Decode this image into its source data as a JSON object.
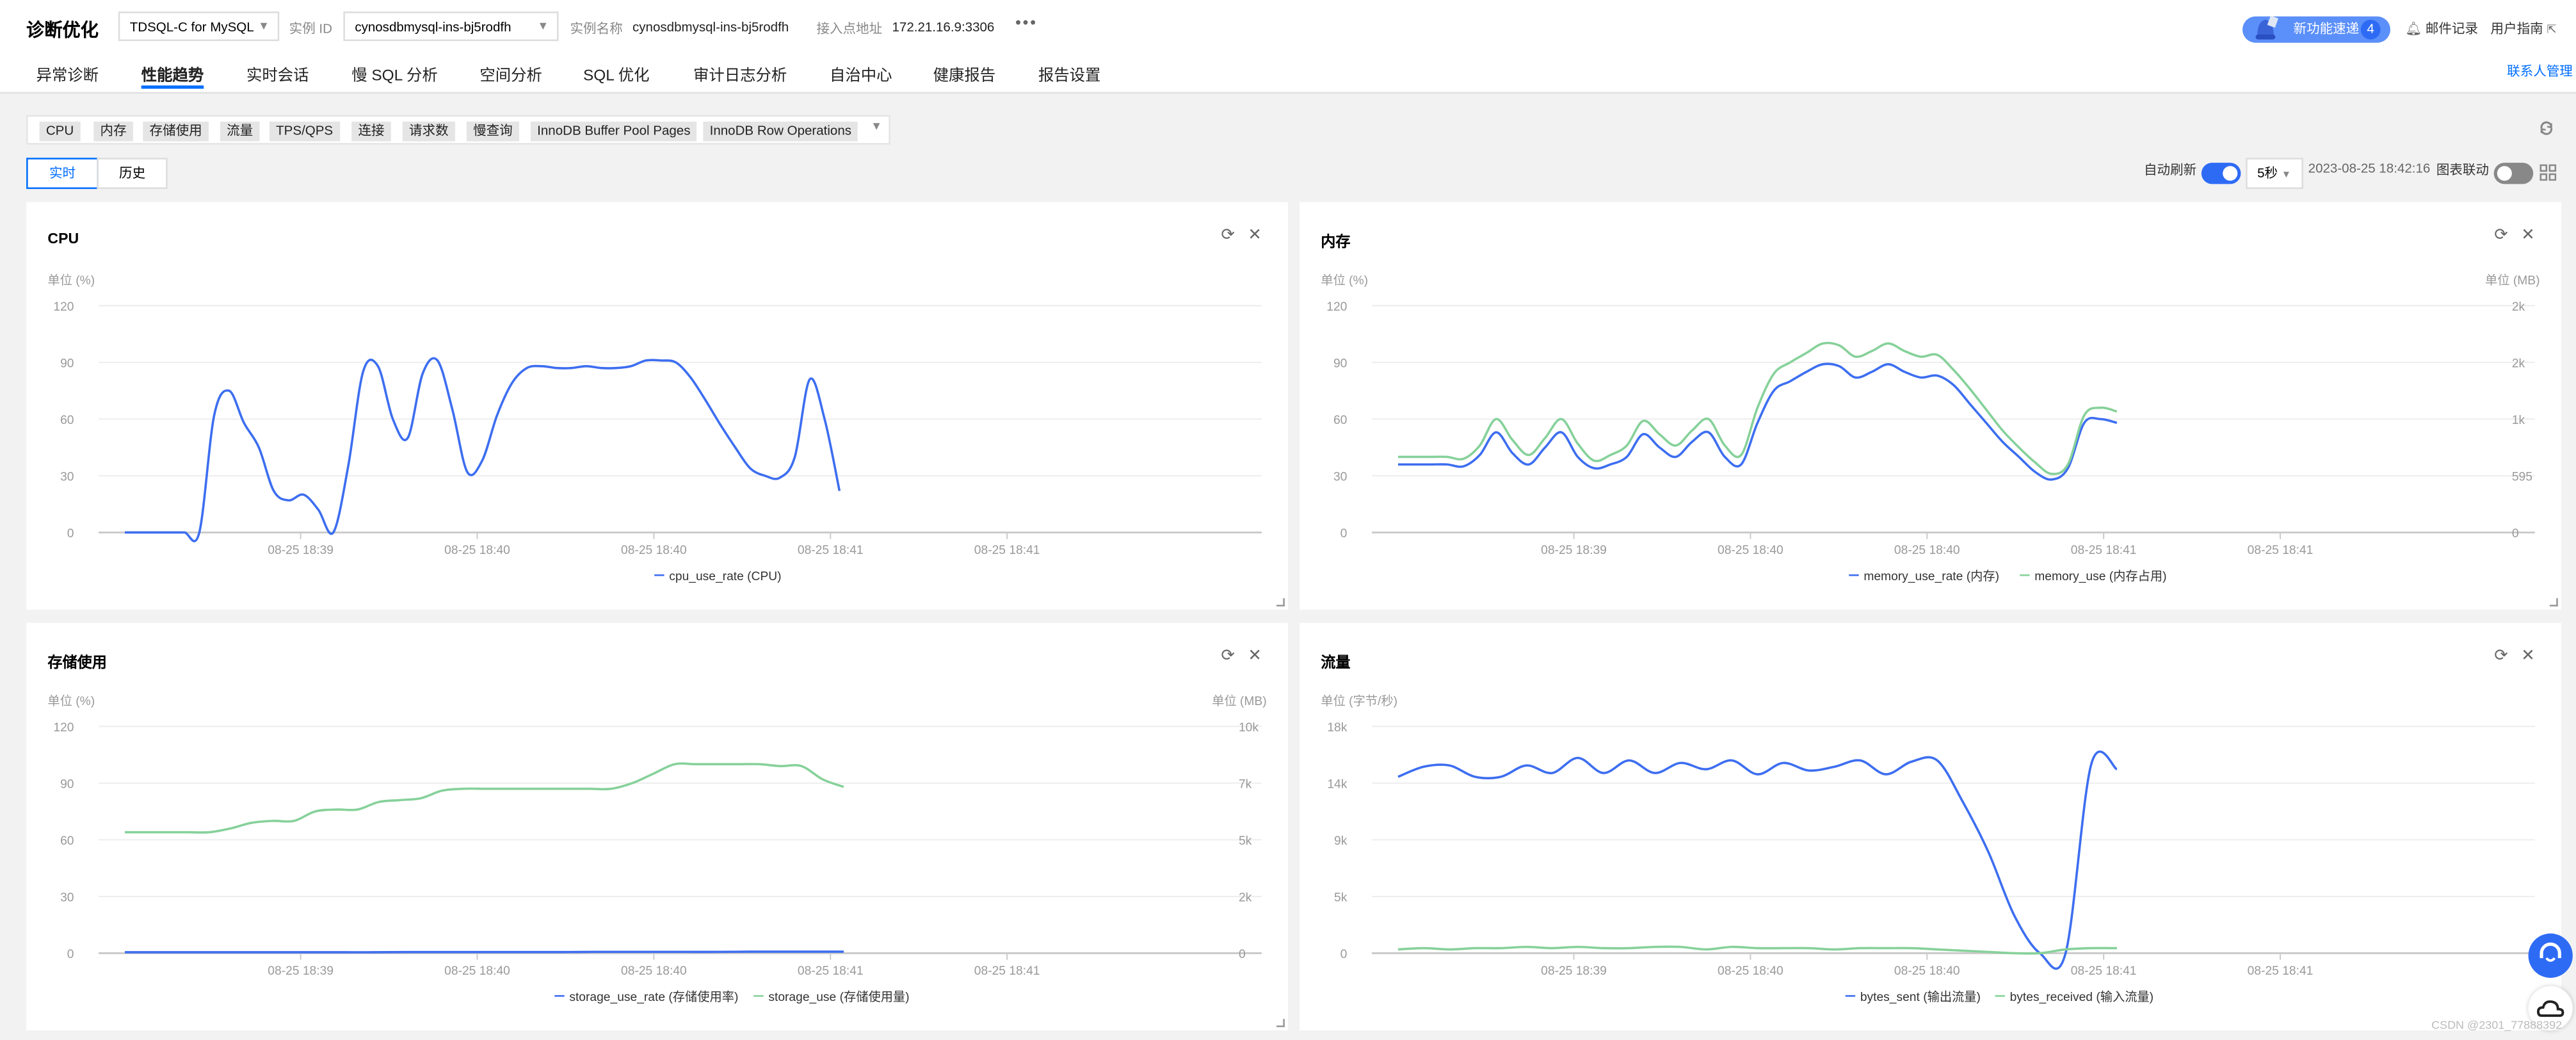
{
  "header": {
    "title": "诊断优化",
    "db_type": "TDSQL-C for MySQL",
    "instance_id_label": "实例 ID",
    "instance_id": "cynosdbmysql-ins-bj5rodfh",
    "instance_name_label": "实例名称",
    "instance_name": "cynosdbmysql-ins-bj5rodfh",
    "endpoint_label": "接入点地址",
    "endpoint": "172.21.16.9:3306",
    "more": "•••",
    "new_features_label": "新功能速递",
    "new_features_count": "4",
    "mail_label": "邮件记录",
    "guide_label": "用户指南",
    "contact_label": "联系人管理"
  },
  "tabs": [
    {
      "label": "异常诊断",
      "active": false
    },
    {
      "label": "性能趋势",
      "active": true
    },
    {
      "label": "实时会话",
      "active": false
    },
    {
      "label": "慢 SQL 分析",
      "active": false
    },
    {
      "label": "空间分析",
      "active": false
    },
    {
      "label": "SQL 优化",
      "active": false
    },
    {
      "label": "审计日志分析",
      "active": false
    },
    {
      "label": "自治中心",
      "active": false
    },
    {
      "label": "健康报告",
      "active": false
    },
    {
      "label": "报告设置",
      "active": false
    }
  ],
  "metric_chips": [
    "CPU",
    "内存",
    "存储使用",
    "流量",
    "TPS/QPS",
    "连接",
    "请求数",
    "慢查询",
    "InnoDB Buffer Pool Pages",
    "InnoDB Row Operations"
  ],
  "mode": {
    "realtime": "实时",
    "history": "历史",
    "selected": "实时"
  },
  "controls": {
    "auto_refresh_label": "自动刷新",
    "auto_refresh_on": true,
    "interval": "5秒",
    "timestamp": "2023-08-25 18:42:16",
    "chart_link_label": "图表联动",
    "chart_link_on": false
  },
  "colors": {
    "accent": "#006eff",
    "series_blue": "#3d6ef0",
    "series_green": "#86d19a"
  },
  "watermark": "CSDN @2301_77888392",
  "chart_data": [
    {
      "type": "line",
      "title": "CPU",
      "ylabel": "单位 (%)",
      "ylim": [
        0,
        120
      ],
      "yticks": [
        "0",
        "30",
        "60",
        "90",
        "120"
      ],
      "xticks": [
        "08-25 18:39",
        "08-25 18:40",
        "08-25 18:40",
        "08-25 18:41",
        "08-25 18:41"
      ],
      "series": [
        {
          "name": "cpu_use_rate (CPU)",
          "color": "#3d6ef0",
          "axis": "left",
          "values": [
            0,
            0,
            0,
            0,
            0,
            0,
            62,
            75,
            58,
            45,
            22,
            17,
            20,
            12,
            0,
            35,
            85,
            88,
            60,
            50,
            84,
            91,
            65,
            32,
            38,
            62,
            79,
            87,
            88,
            87,
            87,
            88,
            87,
            87,
            88,
            91,
            91,
            90,
            82,
            70,
            57,
            45,
            34,
            30,
            29,
            40,
            81,
            60,
            22
          ]
        }
      ]
    },
    {
      "type": "line",
      "title": "内存",
      "ylabel": "单位 (%)",
      "ylabel_right": "单位 (MB)",
      "ylim": [
        0,
        120
      ],
      "yticks": [
        "0",
        "30",
        "60",
        "90",
        "120"
      ],
      "yticks_right": [
        "0",
        "595",
        "1k",
        "2k",
        "2k"
      ],
      "xticks": [
        "08-25 18:39",
        "08-25 18:40",
        "08-25 18:40",
        "08-25 18:41",
        "08-25 18:41"
      ],
      "series": [
        {
          "name": "memory_use_rate (内存)",
          "color": "#3d6ef0",
          "axis": "left",
          "values": [
            36,
            36,
            36,
            36,
            35,
            41,
            53,
            42,
            36,
            45,
            53,
            40,
            34,
            36,
            40,
            52,
            45,
            40,
            48,
            53,
            40,
            36,
            58,
            75,
            80,
            85,
            89,
            88,
            82,
            85,
            89,
            85,
            82,
            83,
            78,
            68,
            58,
            48,
            40,
            32,
            28,
            34,
            58,
            60,
            58
          ]
        },
        {
          "name": "memory_use (内存占用)",
          "color": "#86d19a",
          "axis": "right",
          "values": [
            40,
            40,
            40,
            40,
            39,
            46,
            60,
            49,
            41,
            50,
            60,
            47,
            38,
            41,
            46,
            59,
            52,
            46,
            54,
            60,
            46,
            41,
            66,
            84,
            90,
            95,
            100,
            99,
            93,
            96,
            100,
            96,
            93,
            94,
            86,
            76,
            65,
            54,
            45,
            37,
            31,
            36,
            62,
            66,
            64
          ]
        }
      ]
    },
    {
      "type": "line",
      "title": "存储使用",
      "ylabel": "单位 (%)",
      "ylabel_right": "单位 (MB)",
      "ylim": [
        0,
        120
      ],
      "yticks": [
        "0",
        "30",
        "60",
        "90",
        "120"
      ],
      "yticks_right": [
        "0",
        "2k",
        "5k",
        "7k",
        "10k"
      ],
      "xticks": [
        "08-25 18:39",
        "08-25 18:40",
        "08-25 18:40",
        "08-25 18:41",
        "08-25 18:41"
      ],
      "series": [
        {
          "name": "storage_use_rate (存储使用率)",
          "color": "#3d6ef0",
          "axis": "left",
          "values": [
            0.5,
            0.5,
            0.5,
            0.5,
            0.5,
            0.5,
            0.5,
            0.5,
            0.5,
            0.6,
            0.6,
            0.6,
            0.6,
            0.6,
            0.6,
            0.7,
            0.7,
            0.7,
            0.7,
            0.7,
            0.8,
            0.8,
            0.8,
            0.8
          ]
        },
        {
          "name": "storage_use (存储使用量)",
          "color": "#86d19a",
          "axis": "right",
          "values": [
            64,
            64,
            64,
            64,
            64,
            66,
            69,
            70,
            70,
            75,
            76,
            76,
            80,
            81,
            82,
            86,
            87,
            87,
            87,
            87,
            87,
            87,
            87,
            87,
            90,
            95,
            100,
            100,
            100,
            100,
            100,
            99,
            99,
            92,
            88
          ]
        }
      ]
    },
    {
      "type": "line",
      "title": "流量",
      "ylabel": "单位 (字节/秒)",
      "ylim": [
        0,
        18000
      ],
      "yticks": [
        "0",
        "5k",
        "9k",
        "14k",
        "18k"
      ],
      "xticks": [
        "08-25 18:39",
        "08-25 18:40",
        "08-25 18:40",
        "08-25 18:41",
        "08-25 18:41"
      ],
      "series": [
        {
          "name": "bytes_sent (输出流量)",
          "color": "#3d6ef0",
          "axis": "left",
          "values": [
            14000,
            14800,
            14900,
            14000,
            14000,
            14900,
            14300,
            15500,
            14300,
            15300,
            14300,
            15100,
            14600,
            15300,
            14200,
            15100,
            14500,
            14800,
            15300,
            14200,
            15200,
            15300,
            12000,
            8000,
            3000,
            0,
            0,
            15000,
            14600
          ]
        },
        {
          "name": "bytes_received (输入流量)",
          "color": "#86d19a",
          "axis": "left",
          "values": [
            300,
            400,
            300,
            400,
            400,
            500,
            400,
            500,
            400,
            400,
            500,
            500,
            300,
            500,
            400,
            400,
            400,
            300,
            400,
            400,
            400,
            300,
            200,
            100,
            0,
            0,
            300,
            400,
            400
          ]
        }
      ]
    }
  ]
}
